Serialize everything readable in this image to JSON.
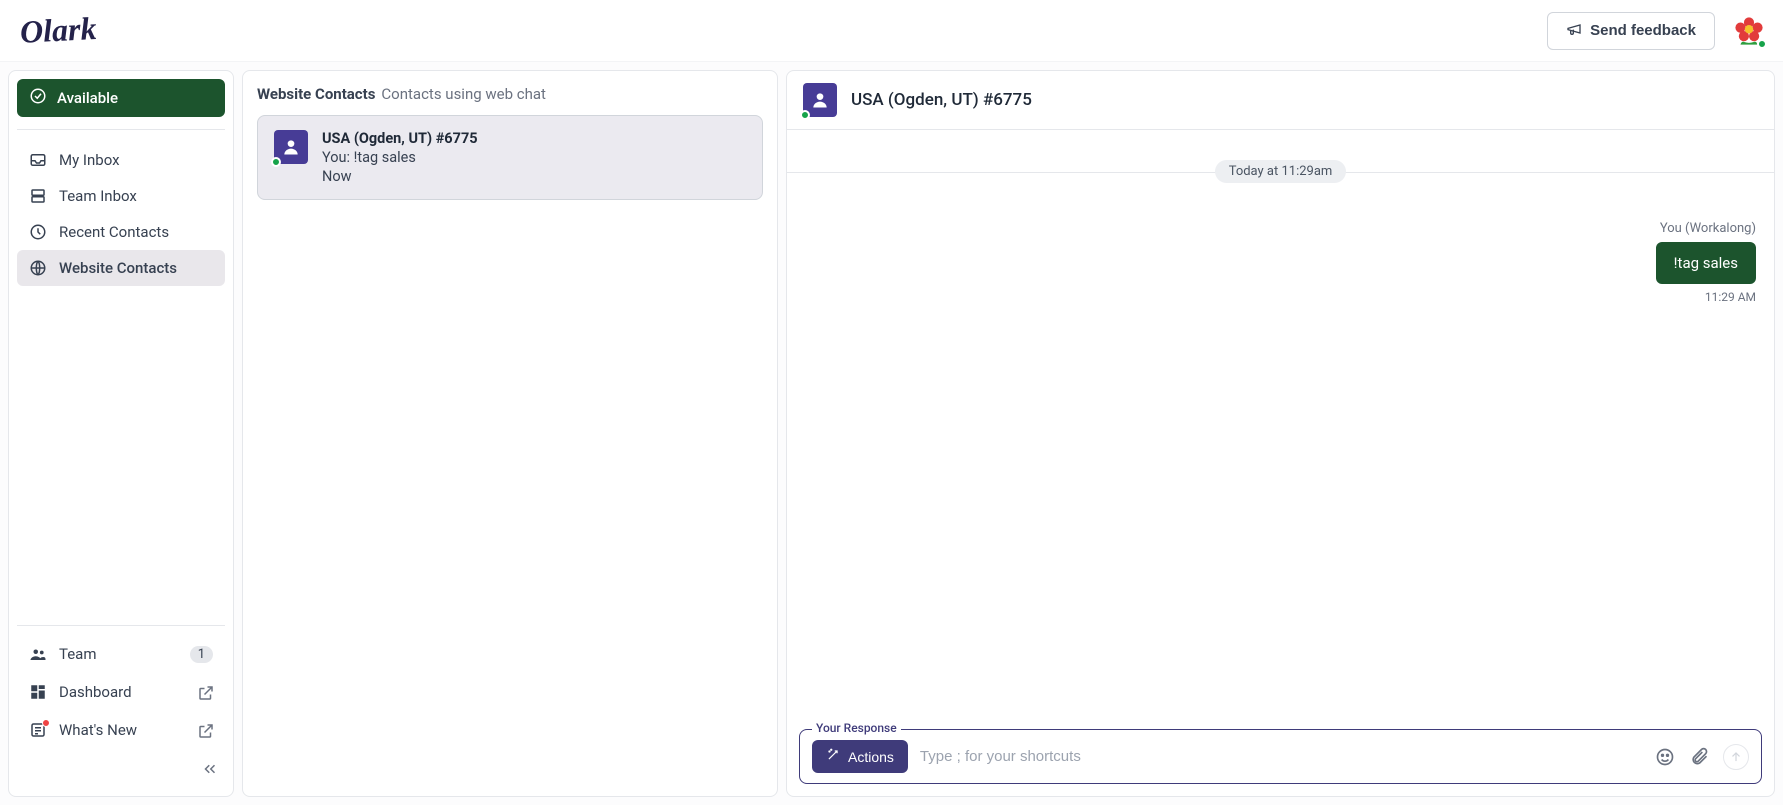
{
  "header": {
    "brand": "Olark",
    "feedback_label": "Send feedback"
  },
  "sidebar": {
    "status_label": "Available",
    "nav": {
      "my_inbox": "My Inbox",
      "team_inbox": "Team Inbox",
      "recent_contacts": "Recent Contacts",
      "website_contacts": "Website Contacts"
    },
    "footer": {
      "team_label": "Team",
      "team_count": "1",
      "dashboard_label": "Dashboard",
      "whats_new_label": "What's New"
    }
  },
  "contacts_panel": {
    "title": "Website Contacts",
    "subtitle": "Contacts using web chat",
    "items": [
      {
        "name": "USA (Ogden, UT) #6775",
        "preview": "You: !tag sales",
        "time": "Now"
      }
    ]
  },
  "chat": {
    "contact_name": "USA (Ogden, UT) #6775",
    "date_label": "Today at 11:29am",
    "sender_label": "You (Workalong)",
    "message_text": "!tag sales",
    "message_time": "11:29 AM",
    "composer": {
      "label": "Your Response",
      "actions_label": "Actions",
      "placeholder": "Type ; for your shortcuts"
    }
  }
}
